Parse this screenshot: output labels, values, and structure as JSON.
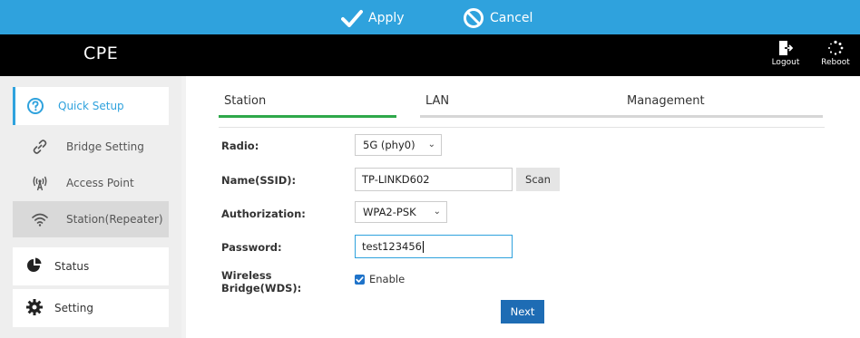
{
  "actions": {
    "apply_label": "Apply",
    "cancel_label": "Cancel"
  },
  "header": {
    "brand": "CPE",
    "logout_label": "Logout",
    "reboot_label": "Reboot"
  },
  "sidebar": {
    "quick_setup": "Quick Setup",
    "sub_items": [
      {
        "label": "Bridge Setting",
        "icon": "link-icon"
      },
      {
        "label": "Access Point",
        "icon": "antenna-icon"
      },
      {
        "label": "Station(Repeater)",
        "icon": "wifi-icon"
      }
    ],
    "status": "Status",
    "setting": "Setting"
  },
  "tabs": [
    {
      "label": "Station",
      "active": true
    },
    {
      "label": "LAN",
      "active": false
    },
    {
      "label": "Management",
      "active": false
    }
  ],
  "form": {
    "radio_label": "Radio:",
    "radio_value": "5G (phy0)",
    "ssid_label": "Name(SSID):",
    "ssid_value": "TP-LINKD602",
    "scan_label": "Scan",
    "auth_label": "Authorization:",
    "auth_value": "WPA2-PSK",
    "password_label": "Password:",
    "password_value": "test123456",
    "wds_label_line1": "Wireless",
    "wds_label_line2": "Bridge(WDS):",
    "wds_checked": true,
    "wds_option": "Enable",
    "next_label": "Next"
  },
  "colors": {
    "accent_blue": "#2fa2dd",
    "active_tab_green": "#2ea84a",
    "primary_button": "#1e6cb4"
  }
}
